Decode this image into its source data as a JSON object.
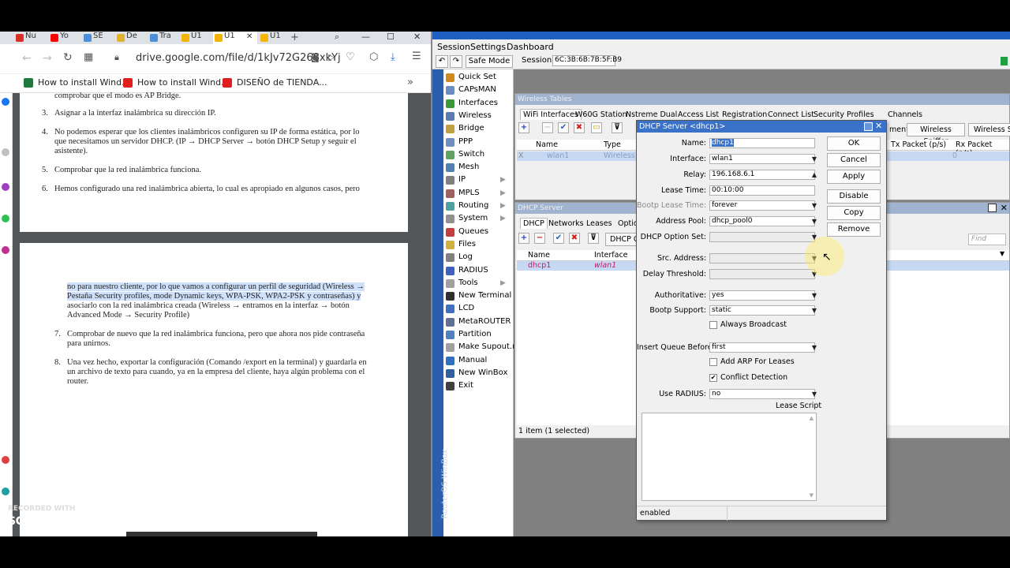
{
  "browser": {
    "tabs": [
      "Nu",
      "Yo",
      "SE",
      "De",
      "Tra",
      "U1",
      "U1",
      "U1"
    ],
    "new_tab": "+",
    "url": "drive.google.com/file/d/1kJv72G268xkYj",
    "bookmarks": [
      "How to install Wind...",
      "How to install Wind...",
      "DISEÑO de TIENDA..."
    ],
    "more": "»"
  },
  "doc": {
    "page1": [
      {
        "t": "comprobar que el modo es AP Bridge.",
        "n": ""
      },
      {
        "t": "Asignar a la interfaz inalámbrica su dirección IP.",
        "n": "3."
      },
      {
        "t": "No podemos esperar que los clientes inalámbricos configuren su IP de forma estática, por lo",
        "n": "4."
      },
      {
        "t": "que necesitamos un servidor DHCP. (IP → DHCP Server → botón DHCP Setup y seguir el",
        "n": ""
      },
      {
        "t": "asistente).",
        "n": ""
      },
      {
        "t": "Comprobar que la red inalámbrica funciona.",
        "n": "5."
      },
      {
        "t": "Hemos configurado una red inalámbrica abierta, lo cual es apropiado en algunos casos, pero",
        "n": "6."
      }
    ],
    "page2": [
      {
        "t": "no para nuestro cliente, por lo que vamos a configurar un perfil de seguridad (Wireless →",
        "n": ""
      },
      {
        "t": "Pestaña Security profiles, mode Dynamic keys, WPA-PSK, WPA2-PSK y contraseñas) y",
        "n": ""
      },
      {
        "t": "asociarlo con la red inalámbrica creada (Wireless → entramos en la interfaz → botón",
        "n": ""
      },
      {
        "t": "Advanced Mode → Security Profile)",
        "n": ""
      },
      {
        "t": "Comprobar de nuevo que la red inalámbrica funciona, pero que ahora nos pide contraseña",
        "n": "7."
      },
      {
        "t": "para unirnos.",
        "n": ""
      },
      {
        "t": "Una vez hecho, exportar la configuración (Comando /export en la terminal) y guardarla en",
        "n": "8."
      },
      {
        "t": "un archivo de texto para cuando, ya en la empresa del cliente, haya algún problema con el",
        "n": ""
      },
      {
        "t": "router.",
        "n": ""
      }
    ]
  },
  "winbox": {
    "menu": [
      "Session",
      "Settings",
      "Dashboard"
    ],
    "safe_mode": "Safe Mode",
    "session_label": "Session:",
    "session_value": "6C:3B:6B:7B:5F:B9",
    "side_label": "RouterOS WinBox",
    "sidebar": [
      {
        "label": "Quick Set",
        "color": "#d08a20",
        "arrow": false
      },
      {
        "label": "CAPsMAN",
        "color": "#6a8cc0",
        "arrow": false
      },
      {
        "label": "Interfaces",
        "color": "#3a9a3a",
        "arrow": false
      },
      {
        "label": "Wireless",
        "color": "#5a7ab0",
        "arrow": false
      },
      {
        "label": "Bridge",
        "color": "#c0a040",
        "arrow": false
      },
      {
        "label": "PPP",
        "color": "#7090c0",
        "arrow": false
      },
      {
        "label": "Switch",
        "color": "#60a060",
        "arrow": false
      },
      {
        "label": "Mesh",
        "color": "#5080b0",
        "arrow": false
      },
      {
        "label": "IP",
        "color": "#808080",
        "arrow": true
      },
      {
        "label": "MPLS",
        "color": "#a06060",
        "arrow": true
      },
      {
        "label": "Routing",
        "color": "#50a0a0",
        "arrow": true
      },
      {
        "label": "System",
        "color": "#909090",
        "arrow": true
      },
      {
        "label": "Queues",
        "color": "#c04040",
        "arrow": false
      },
      {
        "label": "Files",
        "color": "#d0b040",
        "arrow": false
      },
      {
        "label": "Log",
        "color": "#808080",
        "arrow": false
      },
      {
        "label": "RADIUS",
        "color": "#4060c0",
        "arrow": false
      },
      {
        "label": "Tools",
        "color": "#a0a0a0",
        "arrow": true
      },
      {
        "label": "New Terminal",
        "color": "#303030",
        "arrow": false
      },
      {
        "label": "LCD",
        "color": "#4070c0",
        "arrow": false
      },
      {
        "label": "MetaROUTER",
        "color": "#607090",
        "arrow": false
      },
      {
        "label": "Partition",
        "color": "#5080c0",
        "arrow": false
      },
      {
        "label": "Make Supout.rif",
        "color": "#a0a0a0",
        "arrow": false
      },
      {
        "label": "Manual",
        "color": "#3070c0",
        "arrow": false
      },
      {
        "label": "New WinBox",
        "color": "#3060a0",
        "arrow": false
      },
      {
        "label": "Exit",
        "color": "#404040",
        "arrow": false
      }
    ],
    "wireless": {
      "title": "Wireless Tables",
      "tabs": [
        "WiFi Interfaces",
        "W60G Station",
        "Nstreme Dual",
        "Access List",
        "Registration",
        "Connect List",
        "Security Profiles",
        "Channels"
      ],
      "right_buttons": [
        "ment",
        "Wireless Sniffer",
        "Wireless Sn"
      ],
      "columns": [
        "Name",
        "Type"
      ],
      "right_columns": [
        "Tx Packet (p/s)",
        "Rx Packet (p/s)"
      ],
      "row": {
        "flag": "X",
        "name": "wlan1",
        "type": "Wireless",
        "tx": "0"
      }
    },
    "dhcp": {
      "title": "DHCP Server",
      "tabs": [
        "DHCP",
        "Networks",
        "Leases",
        "Optio"
      ],
      "config_btn": "DHCP C",
      "find": "Find",
      "columns": [
        "Name",
        "Interface"
      ],
      "row": {
        "name": "dhcp1",
        "interface": "wlan1"
      },
      "status": "1 item (1 selected)"
    },
    "dialog": {
      "title": "DHCP Server <dhcp1>",
      "fields": [
        {
          "label": "Name:",
          "value": "dhcp1",
          "dd": "",
          "disabled": false
        },
        {
          "label": "Interface:",
          "value": "wlan1",
          "dd": "▼",
          "disabled": false
        },
        {
          "label": "Relay:",
          "value": "196.168.6.1",
          "dd": "▲",
          "disabled": false
        },
        {
          "label": "Lease Time:",
          "value": "00:10:00",
          "dd": "",
          "disabled": false
        },
        {
          "label": "Bootp Lease Time:",
          "value": "forever",
          "dd": "▼",
          "disabled": false
        },
        {
          "label": "Address Pool:",
          "value": "dhcp_pool0",
          "dd": "▼",
          "disabled": false
        },
        {
          "label": "DHCP Option Set:",
          "value": "",
          "dd": "▼",
          "disabled": true
        },
        {
          "label": "Src. Address:",
          "value": "",
          "dd": "▼",
          "disabled": true
        },
        {
          "label": "Delay Threshold:",
          "value": "",
          "dd": "▼",
          "disabled": true
        },
        {
          "label": "Authoritative:",
          "value": "yes",
          "dd": "▼",
          "disabled": false
        },
        {
          "label": "Bootp Support:",
          "value": "static",
          "dd": "▼",
          "disabled": false
        },
        {
          "label": "Insert Queue Before:",
          "value": "first",
          "dd": "▼",
          "disabled": false
        },
        {
          "label": "Use RADIUS:",
          "value": "no",
          "dd": "▼",
          "disabled": false
        }
      ],
      "checks": [
        {
          "label": "Always Broadcast",
          "checked": false
        },
        {
          "label": "Add ARP For Leases",
          "checked": false
        },
        {
          "label": "Conflict Detection",
          "checked": true
        }
      ],
      "lease_script": "Lease Script",
      "buttons": [
        "OK",
        "Cancel",
        "Apply",
        "Disable",
        "Copy",
        "Remove"
      ],
      "status": "enabled"
    }
  },
  "watermark": {
    "line1": "RECORDED WITH",
    "line2": "SCREENCAST ◉ MATIC"
  }
}
